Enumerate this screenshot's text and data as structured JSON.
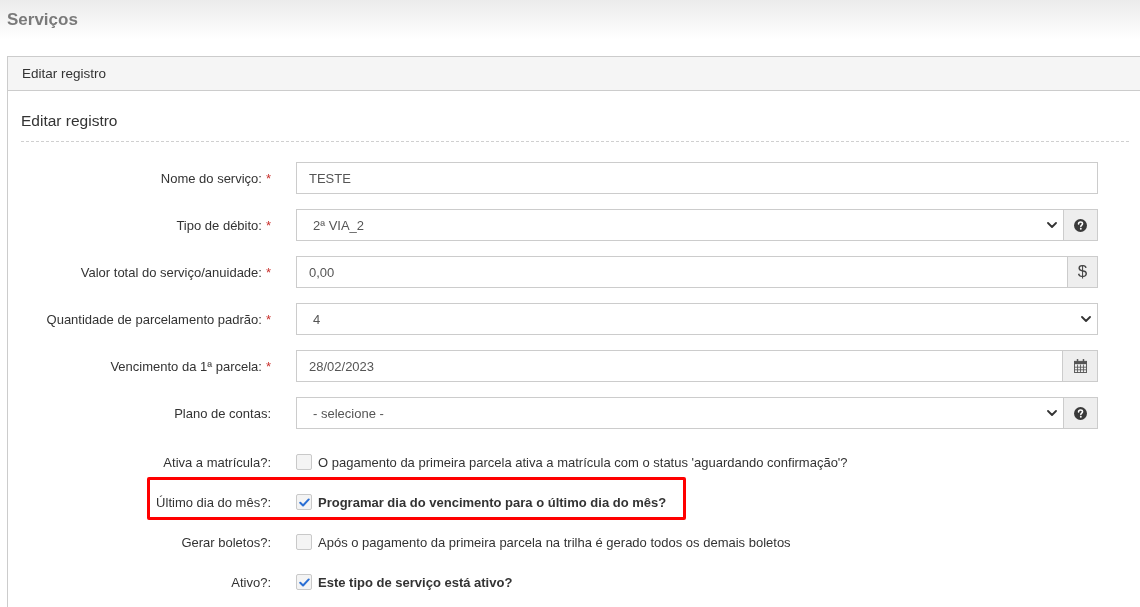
{
  "page_title": "Serviços",
  "panel": {
    "heading": "Editar registro",
    "section_title": "Editar registro",
    "fields": [
      {
        "kind": "text",
        "label": "Nome do serviço:",
        "required_mark": "*",
        "value": "TESTE"
      },
      {
        "kind": "select",
        "label": "Tipo de débito:",
        "required_mark": "*",
        "value": "2ª VIA_2",
        "help": true
      },
      {
        "kind": "text",
        "label": "Valor total do serviço/anuidade:",
        "required_mark": "*",
        "value": "0,00",
        "addon": "$"
      },
      {
        "kind": "select",
        "label": "Quantidade de parcelamento padrão:",
        "required_mark": "*",
        "value": "4",
        "help": false
      },
      {
        "kind": "date",
        "label": "Vencimento da 1ª parcela:",
        "required_mark": "*",
        "value": "28/02/2023"
      },
      {
        "kind": "select",
        "label": "Plano de contas:",
        "value": "- selecione -",
        "help": true
      }
    ],
    "checks": [
      {
        "label": "Ativa a matrícula?:",
        "text": "O pagamento da primeira parcela ativa a matrícula com o status 'aguardando confirmação'?",
        "checked": false,
        "highlighted": false
      },
      {
        "label": "Último dia do mês?:",
        "text": "Programar dia do vencimento para o último dia do mês?",
        "checked": true,
        "highlighted": true
      },
      {
        "label": "Gerar boletos?:",
        "text": "Após o pagamento da primeira parcela na trilha é gerado todos os demais boletos",
        "checked": false,
        "highlighted": false
      },
      {
        "label": "Ativo?:",
        "text": "Este tipo de serviço está ativo?",
        "checked": true,
        "highlighted": false
      }
    ]
  }
}
